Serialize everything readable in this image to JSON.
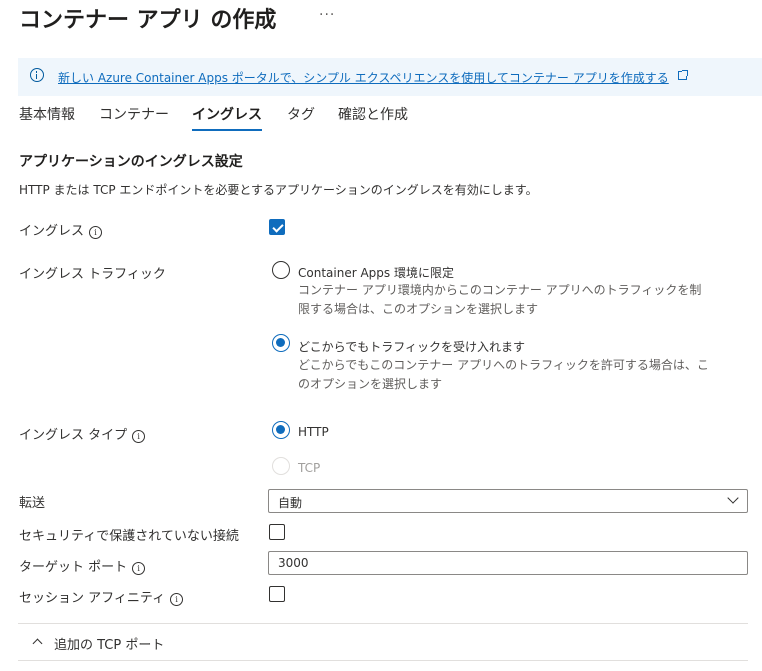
{
  "page": {
    "title": "コンテナー アプリ の作成",
    "more_label": "···"
  },
  "banner": {
    "link_text": "新しい Azure Container Apps ポータルで、シンプル エクスペリエンスを使用してコンテナー アプリを作成する"
  },
  "tabs": [
    {
      "label": "基本情報"
    },
    {
      "label": "コンテナー"
    },
    {
      "label": "イングレス",
      "active": true
    },
    {
      "label": "タグ"
    },
    {
      "label": "確認と作成"
    }
  ],
  "section": {
    "title": "アプリケーションのイングレス設定",
    "description": "HTTP または TCP エンドポイントを必要とするアプリケーションのイングレスを有効にします。"
  },
  "ingress": {
    "label": "イングレス",
    "checked": true
  },
  "traffic": {
    "label": "イングレス トラフィック",
    "options": [
      {
        "label": "Container Apps 環境に限定",
        "desc_line1": "コンテナー アプリ環境内からこのコンテナー アプリへのトラフィックを制",
        "desc_line2": "限する場合は、このオプションを選択します",
        "selected": false
      },
      {
        "label": "どこからでもトラフィックを受け入れます",
        "desc_line1": "どこからでもこのコンテナー アプリへのトラフィックを許可する場合は、こ",
        "desc_line2": "のオプションを選択します",
        "selected": true
      }
    ]
  },
  "ingress_type": {
    "label": "イングレス タイプ",
    "options": [
      {
        "label": "HTTP",
        "selected": true,
        "disabled": false
      },
      {
        "label": "TCP",
        "selected": false,
        "disabled": true
      }
    ]
  },
  "transport": {
    "label": "転送",
    "value": "自動"
  },
  "insecure": {
    "label": "セキュリティで保護されていない接続",
    "checked": false
  },
  "target_port": {
    "label": "ターゲット ポート",
    "value": "3000"
  },
  "session_affinity": {
    "label": "セッション アフィニティ",
    "checked": false
  },
  "additional_tcp": {
    "label": "追加の TCP ポート"
  },
  "icons": {
    "info": "info-icon",
    "external_link": "external-link-icon",
    "checkmark": "checkmark-icon",
    "chevron_down": "chevron-down-icon",
    "chevron_up": "chevron-up-icon"
  },
  "colors": {
    "accent": "#0f6cbd",
    "banner_bg": "#eff6fc",
    "text": "#323130"
  }
}
